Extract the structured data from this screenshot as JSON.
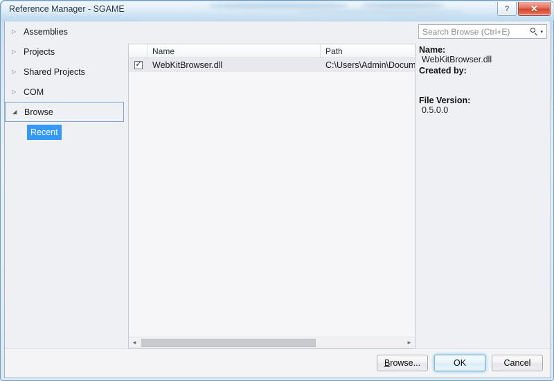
{
  "window": {
    "title": "Reference Manager - SGAME",
    "help_label": "?",
    "close_label": "✕"
  },
  "sidebar": {
    "items": [
      {
        "label": "Assemblies",
        "arrow": "▷",
        "state": "collapsed"
      },
      {
        "label": "Projects",
        "arrow": "▷",
        "state": "collapsed"
      },
      {
        "label": "Shared Projects",
        "arrow": "▷",
        "state": "collapsed"
      },
      {
        "label": "COM",
        "arrow": "▷",
        "state": "collapsed"
      },
      {
        "label": "Browse",
        "arrow": "◢",
        "state": "expanded"
      }
    ],
    "child": {
      "label": "Recent",
      "selected": true
    }
  },
  "search": {
    "placeholder": "Search Browse (Ctrl+E)",
    "value": "",
    "icon": "search-icon",
    "dropdown_arrow": "▾"
  },
  "list": {
    "columns": [
      "Name",
      "Path"
    ],
    "rows": [
      {
        "checked": true,
        "check_glyph": "✓",
        "name": "WebKitBrowser.dll",
        "path": "C:\\Users\\Admin\\Docum"
      }
    ],
    "scroll": {
      "left_arrow": "◄",
      "right_arrow": "►"
    }
  },
  "details": {
    "name_label": "Name:",
    "name_value": "WebKitBrowser.dll",
    "created_by_label": "Created by:",
    "created_by_value": "",
    "file_version_label": "File Version:",
    "file_version_value": "0.5.0.0"
  },
  "footer": {
    "browse_prefix": "B",
    "browse_suffix": "rowse...",
    "ok_label": "OK",
    "cancel_label": "Cancel"
  },
  "colors": {
    "selection_blue": "#3399ff",
    "frame_blue": "#6f9dc4",
    "dialog_bg": "#eff0f4",
    "close_red": "#d4452e"
  }
}
